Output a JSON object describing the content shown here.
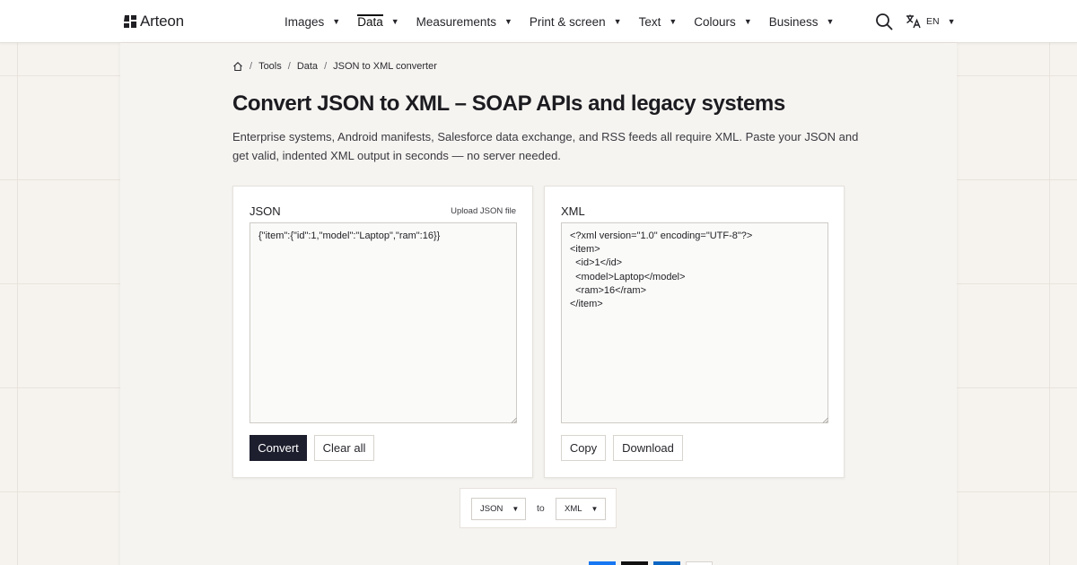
{
  "brand": {
    "name": "Arteon"
  },
  "nav": {
    "items": [
      {
        "label": "Images"
      },
      {
        "label": "Data",
        "active": true
      },
      {
        "label": "Measurements"
      },
      {
        "label": "Print & screen"
      },
      {
        "label": "Text"
      },
      {
        "label": "Colours"
      },
      {
        "label": "Business"
      }
    ],
    "language": "EN"
  },
  "breadcrumb": {
    "items": [
      "Tools",
      "Data",
      "JSON to XML converter"
    ]
  },
  "page": {
    "title": "Convert JSON to XML – SOAP APIs and legacy systems",
    "intro": "Enterprise systems, Android manifests, Salesforce data exchange, and RSS feeds all require XML. Paste your JSON and get valid, indented XML output in seconds — no server needed."
  },
  "input_card": {
    "label": "JSON",
    "upload_label": "Upload JSON file",
    "value": "{\"item\":{\"id\":1,\"model\":\"Laptop\",\"ram\":16}}",
    "convert_label": "Convert",
    "clear_label": "Clear all"
  },
  "output_card": {
    "label": "XML",
    "value": "<?xml version=\"1.0\" encoding=\"UTF-8\"?>\n<item>\n  <id>1</id>\n  <model>Laptop</model>\n  <ram>16</ram>\n</item>",
    "copy_label": "Copy",
    "download_label": "Download"
  },
  "converter": {
    "from": "JSON",
    "to_word": "to",
    "to": "XML"
  },
  "colors": {
    "primary_button": "#1d1f2e",
    "page_background": "#f6f3ee",
    "share_blue": "#1877f2",
    "share_dark": "#111111",
    "share_linkedin": "#0a66c2"
  }
}
